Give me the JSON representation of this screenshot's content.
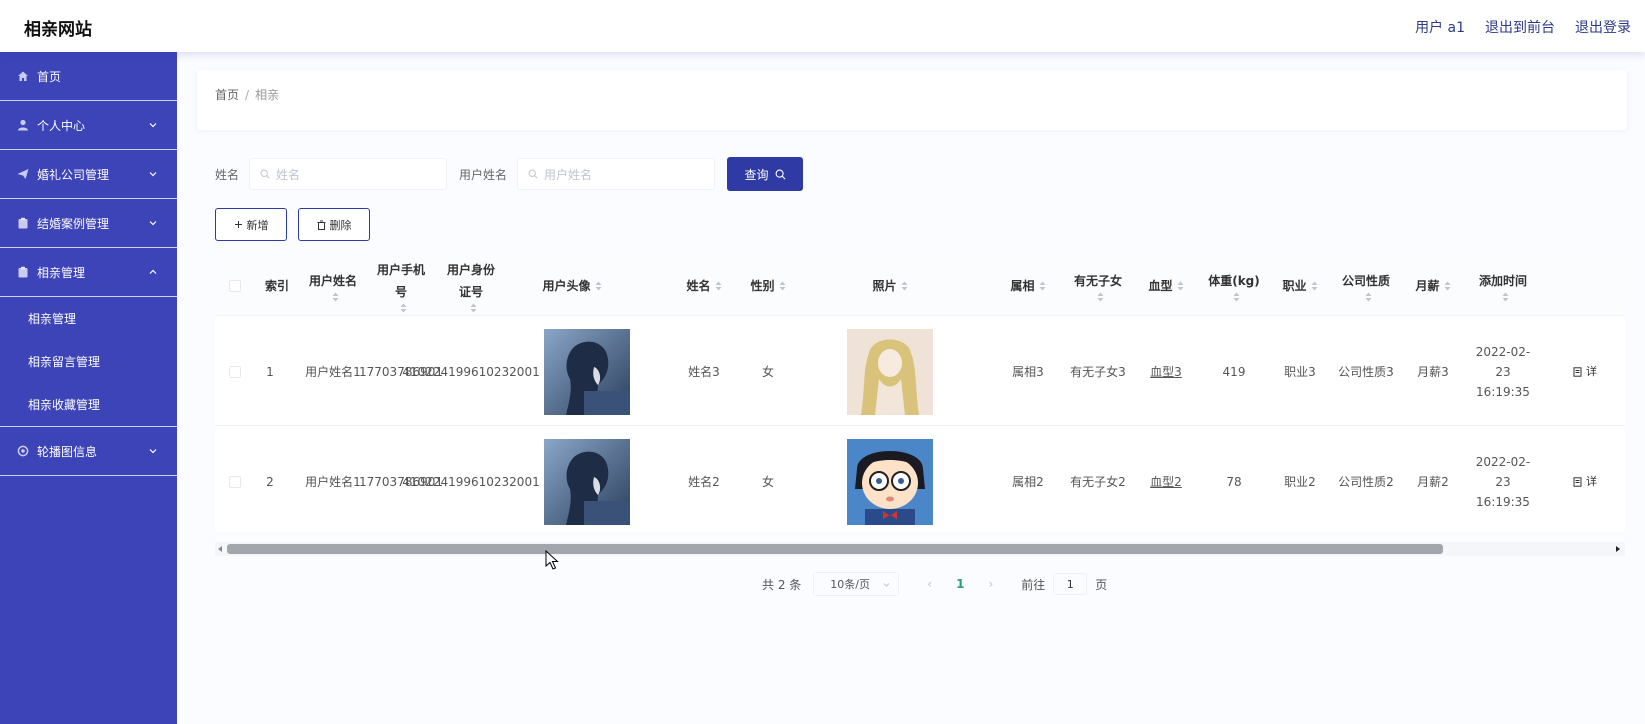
{
  "header": {
    "brand": "相亲网站",
    "user_label": "用户 a1",
    "to_front": "退出到前台",
    "logout": "退出登录"
  },
  "sidebar": {
    "items": [
      {
        "label": "首页",
        "icon": "home-icon"
      },
      {
        "label": "个人中心",
        "icon": "user-icon"
      },
      {
        "label": "婚礼公司管理",
        "icon": "send-icon"
      },
      {
        "label": "结婚案例管理",
        "icon": "clipboard-icon"
      },
      {
        "label": "相亲管理",
        "icon": "clipboard-icon"
      },
      {
        "label": "轮播图信息",
        "icon": "settings-icon"
      }
    ],
    "submenu": [
      "相亲管理",
      "相亲留言管理",
      "相亲收藏管理"
    ]
  },
  "breadcrumb": {
    "home": "首页",
    "sep": "/",
    "current": "相亲"
  },
  "search": {
    "name_label": "姓名",
    "name_placeholder": "姓名",
    "username_label": "用户姓名",
    "username_placeholder": "用户姓名",
    "query_button": "查询"
  },
  "actions": {
    "add": "新增",
    "delete": "删除"
  },
  "table": {
    "headers": {
      "index": "索引",
      "username": "用户姓名",
      "phone": "用户手机号",
      "idcard": "用户身份证号",
      "avatar": "用户头像",
      "name": "姓名",
      "gender": "性别",
      "photo": "照片",
      "zodiac": "属相",
      "children": "有无子女",
      "blood": "血型",
      "weight": "体重(kg)",
      "job": "职业",
      "company": "公司性质",
      "salary": "月薪",
      "added": "添加时间"
    },
    "rows": [
      {
        "index": "1",
        "username": "用户姓名1",
        "phone": "17703786901",
        "idcard": "410224199610232001",
        "name": "姓名3",
        "gender": "女",
        "zodiac": "属相3",
        "children": "有无子女3",
        "blood": "血型3",
        "weight": "419",
        "job": "职业3",
        "company": "公司性质3",
        "salary": "月薪3",
        "added": "2022-02-23 16:19:35",
        "detail": "详"
      },
      {
        "index": "2",
        "username": "用户姓名1",
        "phone": "17703786901",
        "idcard": "410224199610232001",
        "name": "姓名2",
        "gender": "女",
        "zodiac": "属相2",
        "children": "有无子女2",
        "blood": "血型2",
        "weight": "78",
        "job": "职业2",
        "company": "公司性质2",
        "salary": "月薪2",
        "added": "2022-02-23 16:19:35",
        "detail": "详"
      }
    ]
  },
  "pagination": {
    "total": "共 2 条",
    "page_size": "10条/页",
    "current": "1",
    "goto_label": "前往",
    "goto_value": "1",
    "page_unit": "页"
  },
  "colors": {
    "accent": "#2f3aa5",
    "sidebar": "#3d44b7"
  }
}
